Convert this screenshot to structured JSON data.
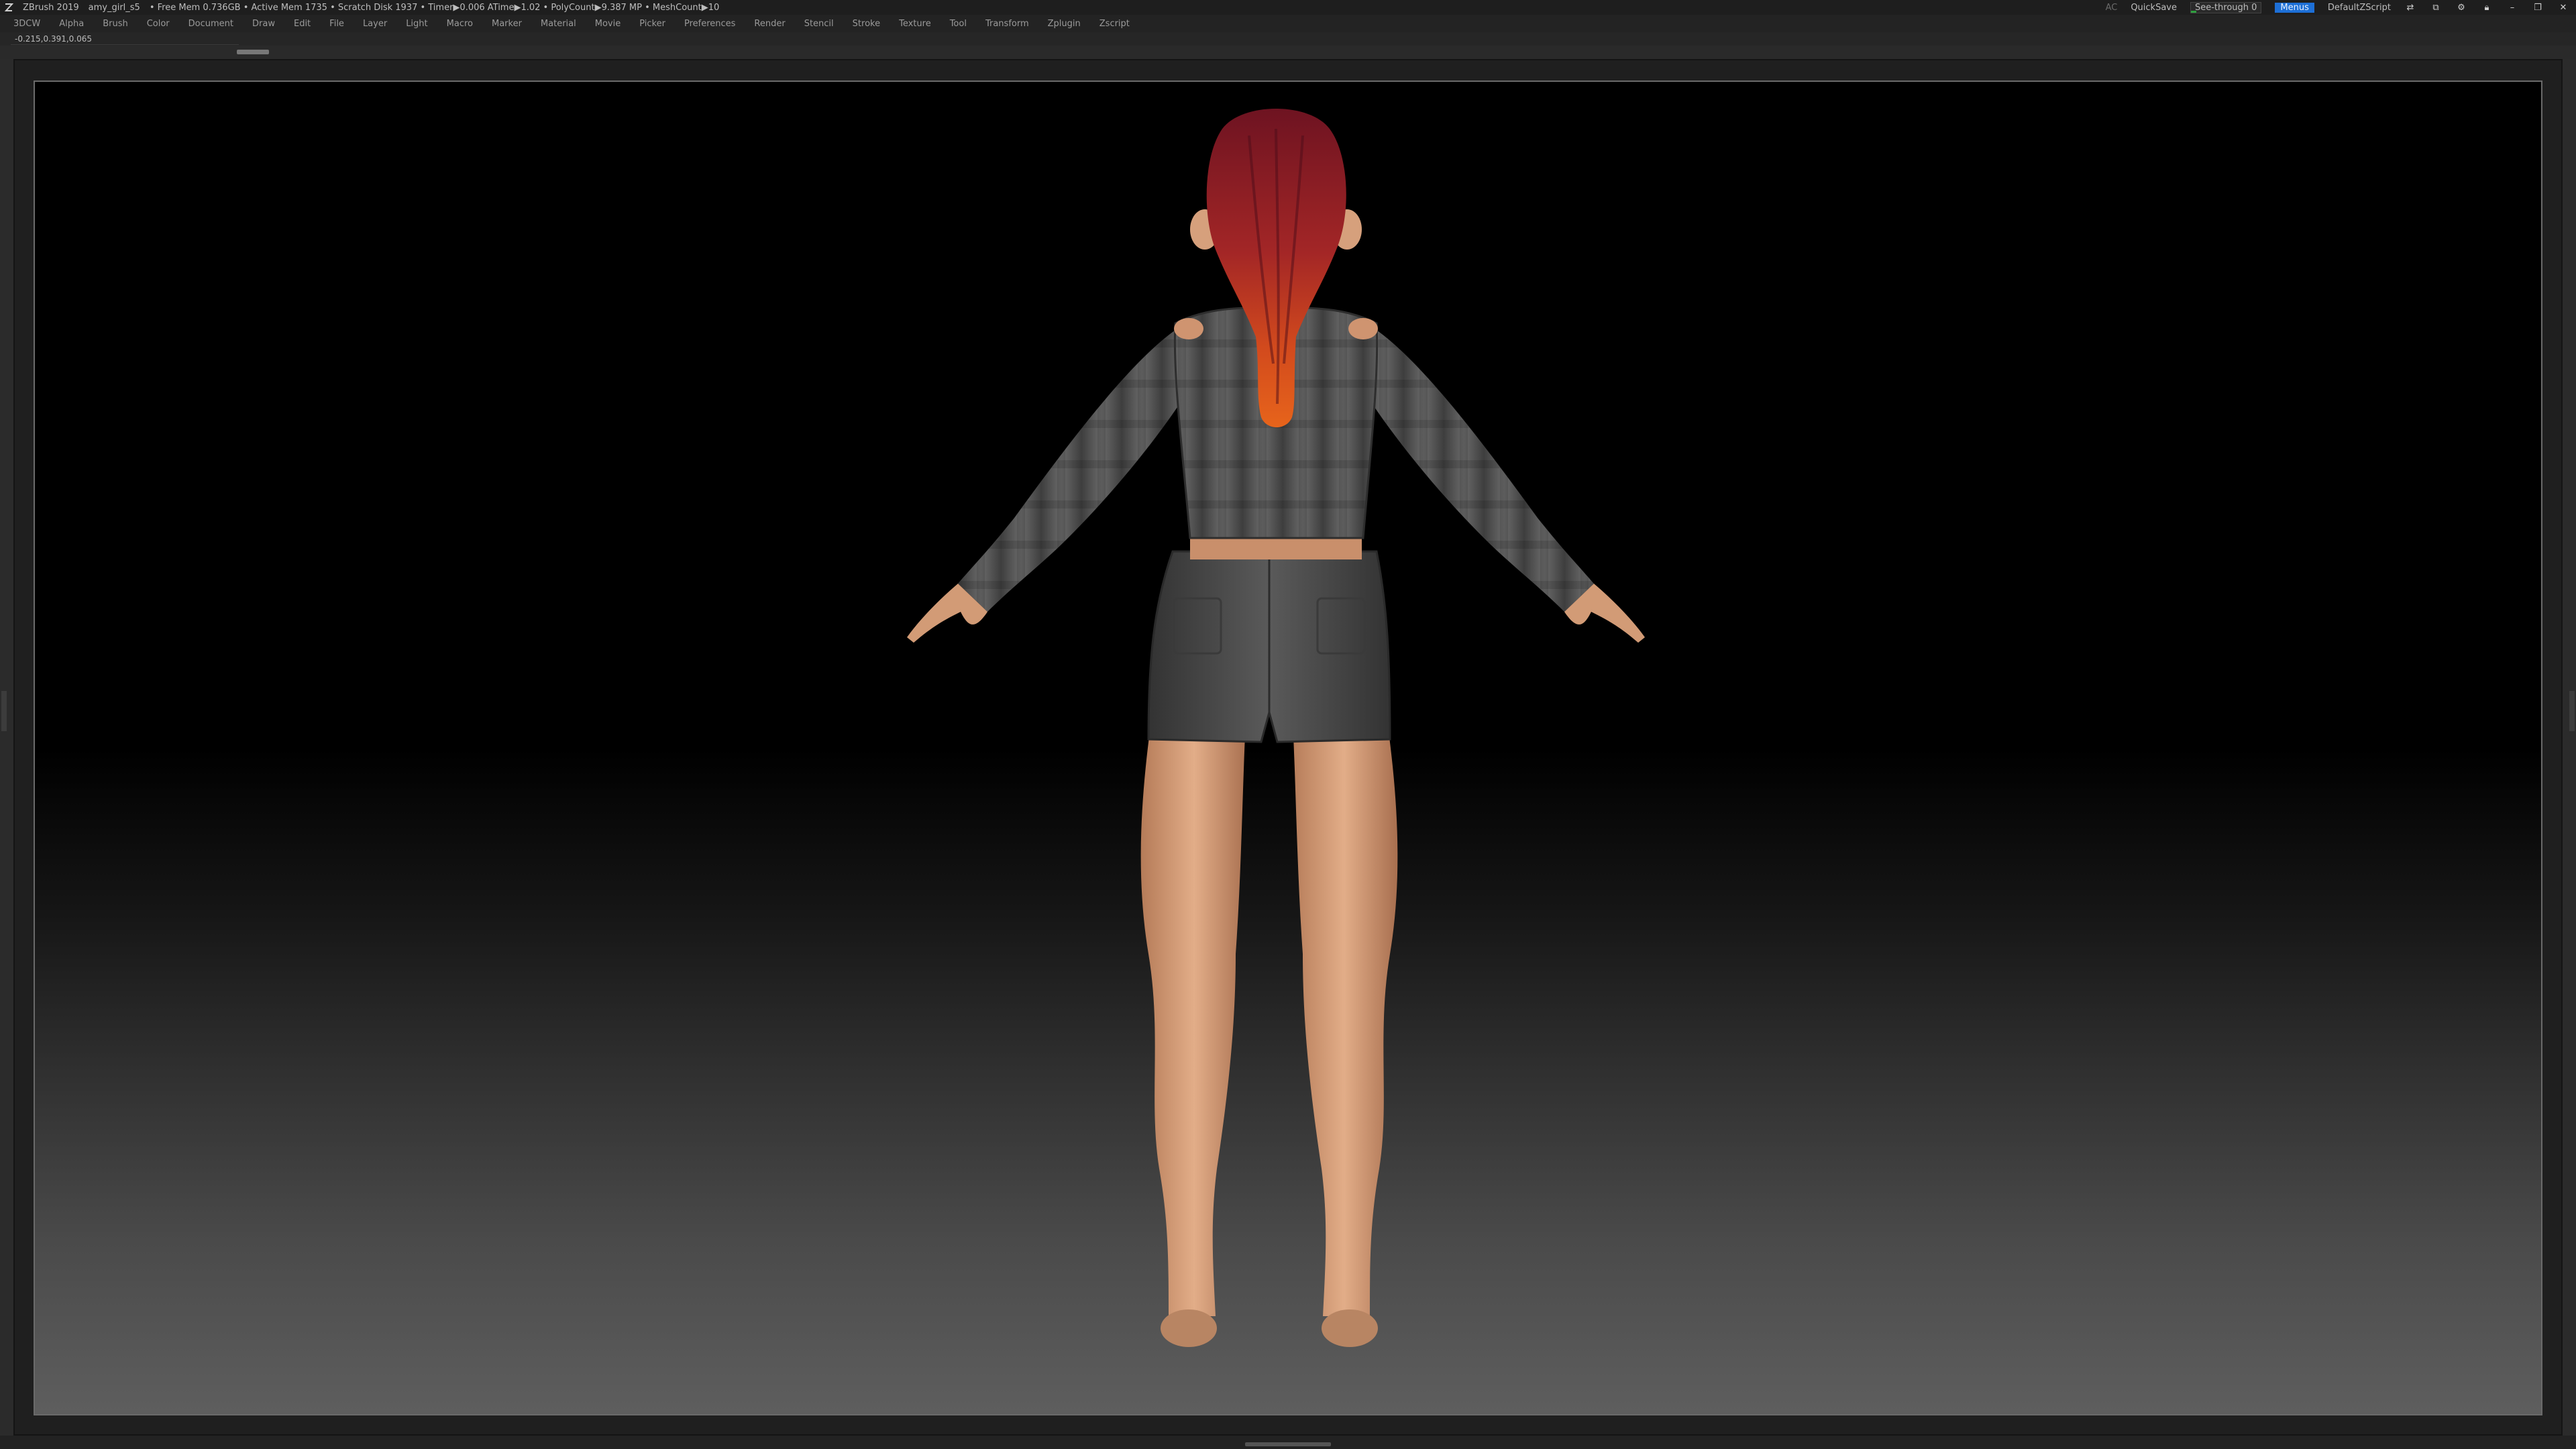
{
  "titlebar": {
    "app": "ZBrush 2019",
    "file": "amy_girl_s5",
    "stats": "• Free Mem 0.736GB • Active Mem 1735 • Scratch Disk 1937 •  Timer▶0.006 ATime▶1.02 • PolyCount▶9.387 MP  • MeshCount▶10",
    "ac": "AC",
    "quicksave": "QuickSave",
    "see_through": "See-through  0",
    "see_through_level": 0,
    "menus": "Menus",
    "script": "DefaultZScript"
  },
  "menu": {
    "items": [
      "3DCW",
      "Alpha",
      "Brush",
      "Color",
      "Document",
      "Draw",
      "Edit",
      "File",
      "Layer",
      "Light",
      "Macro",
      "Marker",
      "Material",
      "Movie",
      "Picker",
      "Preferences",
      "Render",
      "Stencil",
      "Stroke",
      "Texture",
      "Tool",
      "Transform",
      "Zplugin",
      "Zscript"
    ]
  },
  "coords": "-0.215,0.391,0.065",
  "colors": {
    "accent": "#1d6fd6",
    "progress": "#2f9e3f",
    "hair_top": "#7a1624",
    "hair_bottom": "#e0571b",
    "skin": "#d9a07a",
    "shirt": "#5a5a5a",
    "shorts": "#4a4a4a"
  }
}
